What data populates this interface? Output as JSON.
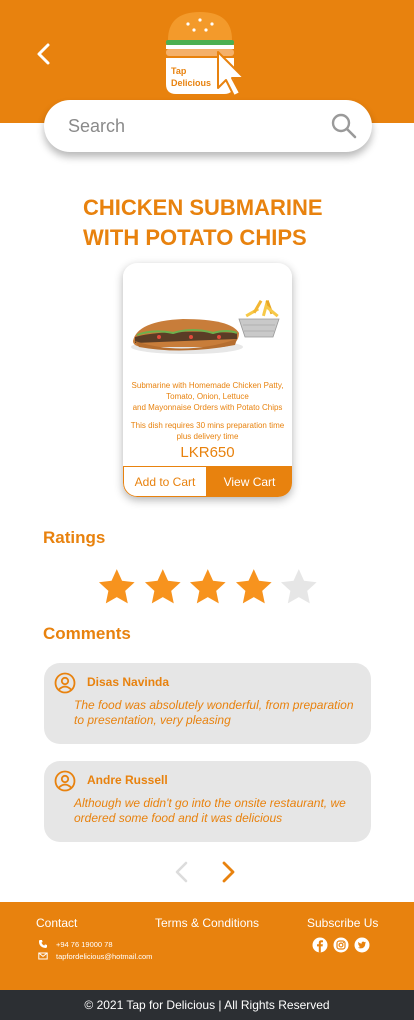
{
  "header": {
    "logo_text_line1": "Tap",
    "logo_text_line2": "Delicious"
  },
  "search": {
    "placeholder": "Search"
  },
  "product": {
    "title_line1": "CHICKEN SUBMARINE",
    "title_line2": "WITH POTATO CHIPS",
    "description_lines": [
      "Submarine with Homemade Chicken Patty,",
      "Tomato, Onion, Lettuce",
      "and Mayonnaise Orders with Potato Chips"
    ],
    "prep_lines": [
      "This dish requires 30 mins preparation time",
      "plus delivery time"
    ],
    "price": "LKR650",
    "add_to_cart_label": "Add to Cart",
    "view_cart_label": "View Cart"
  },
  "ratings": {
    "heading": "Ratings",
    "value": 4,
    "max": 5
  },
  "comments": {
    "heading": "Comments",
    "items": [
      {
        "name": "Disas Navinda",
        "text": "The food was absolutely wonderful, from preparation to presentation, very pleasing"
      },
      {
        "name": "Andre Russell",
        "text": "Although we didn't go into the onsite restaurant, we ordered some food and it was delicious"
      }
    ]
  },
  "footer": {
    "contact_heading": "Contact",
    "terms_label": "Terms & Conditions",
    "subscribe_heading": "Subscribe Us",
    "phone": "+94 76 19000 78",
    "email": "tapfordelicious@hotmail.com",
    "social_icons": [
      "facebook-icon",
      "instagram-icon",
      "twitter-icon"
    ],
    "copyright": "© 2021 Tap for Delicious | All Rights Reserved"
  },
  "colors": {
    "accent": "#e8820e",
    "star_active": "#f7931e",
    "star_inactive": "#e6e6e6",
    "comment_bg": "#e6e6e6",
    "bottom_bar": "#2c2f33"
  }
}
